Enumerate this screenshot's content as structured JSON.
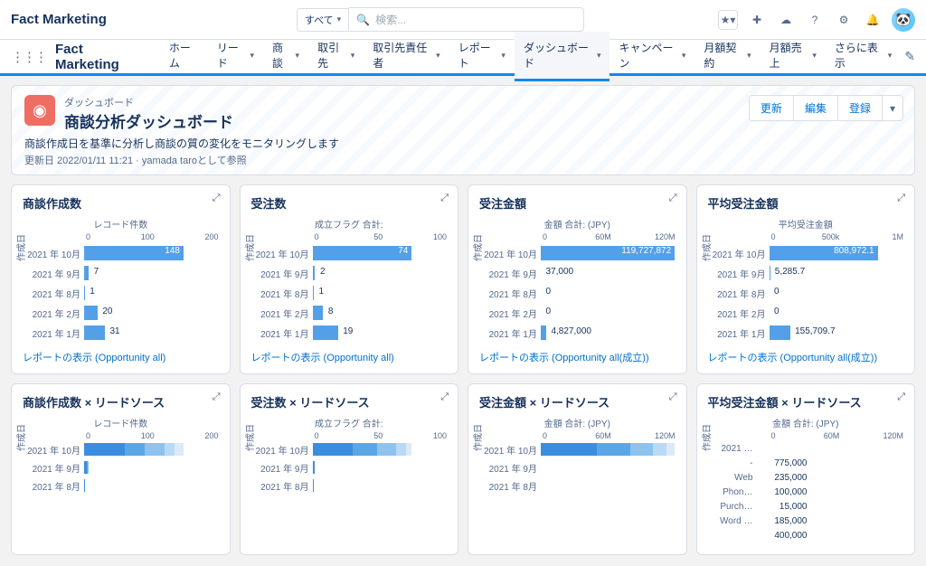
{
  "top": {
    "brand": "Fact Marketing",
    "scope": "すべて",
    "search_placeholder": "検索..."
  },
  "nav": {
    "app": "Fact Marketing",
    "items": [
      "ホーム",
      "リード",
      "商談",
      "取引先",
      "取引先責任者",
      "レポート",
      "ダッシュボード",
      "キャンペーン",
      "月額契約",
      "月額売上",
      "さらに表示"
    ],
    "active_index": 6
  },
  "header": {
    "sub": "ダッシュボード",
    "title": "商談分析ダッシュボード",
    "desc": "商談作成日を基準に分析し商談の質の変化をモニタリングします",
    "date": "更新日 2022/01/11 11:21 · yamada taroとして参照",
    "actions": [
      "更新",
      "編集",
      "登録",
      "▾"
    ]
  },
  "ylabel": "作成日",
  "chart_data": [
    {
      "id": "c1",
      "title": "商談作成数",
      "axis": "レコード件数",
      "ticks": [
        "0",
        "100",
        "200"
      ],
      "type": "bar",
      "max": 200,
      "categories": [
        "2021 年 10月",
        "2021 年 9月",
        "2021 年 8月",
        "2021 年 2月",
        "2021 年 1月"
      ],
      "values": [
        148,
        7,
        1,
        20,
        31
      ],
      "labels": [
        "148",
        "7",
        "1",
        "20",
        "31"
      ],
      "link": "レポートの表示 (Opportunity all)"
    },
    {
      "id": "c2",
      "title": "受注数",
      "axis": "成立フラグ 合計:",
      "ticks": [
        "0",
        "50",
        "100"
      ],
      "type": "bar",
      "max": 100,
      "categories": [
        "2021 年 10月",
        "2021 年 9月",
        "2021 年 8月",
        "2021 年 2月",
        "2021 年 1月"
      ],
      "values": [
        74,
        2,
        1,
        8,
        19
      ],
      "labels": [
        "74",
        "2",
        "1",
        "8",
        "19"
      ],
      "link": "レポートの表示 (Opportunity all)"
    },
    {
      "id": "c3",
      "title": "受注金額",
      "axis": "金額 合計: (JPY)",
      "ticks": [
        "0",
        "60M",
        "120M"
      ],
      "type": "bar",
      "max": 120000000,
      "categories": [
        "2021 年 10月",
        "2021 年 9月",
        "2021 年 8月",
        "2021 年 2月",
        "2021 年 1月"
      ],
      "values": [
        119727872,
        37000,
        0,
        0,
        4827000
      ],
      "labels": [
        "119,727,872",
        "37,000",
        "0",
        "0",
        "4,827,000"
      ],
      "link": "レポートの表示 (Opportunity all(成立))"
    },
    {
      "id": "c4",
      "title": "平均受注金額",
      "axis": "平均受注金額",
      "ticks": [
        "0",
        "500k",
        "1M"
      ],
      "type": "bar",
      "max": 1000000,
      "categories": [
        "2021 年 10月",
        "2021 年 9月",
        "2021 年 8月",
        "2021 年 2月",
        "2021 年 1月"
      ],
      "values": [
        808972.1,
        5285.7,
        0,
        0,
        155709.7
      ],
      "labels": [
        "808,972.1",
        "5,285.7",
        "0",
        "0",
        "155,709.7"
      ],
      "link": "レポートの表示 (Opportunity all(成立))"
    },
    {
      "id": "c5",
      "title": "商談作成数 × リードソース",
      "axis": "レコード件数",
      "ticks": [
        "0",
        "100",
        "200"
      ],
      "type": "stacked",
      "max": 200,
      "categories": [
        "2021 年 10月",
        "2021 年 9月",
        "2021 年 8月"
      ],
      "series_colors": [
        "#3b8ede",
        "#5aa7e8",
        "#8ec2ef",
        "#b9daf6",
        "#dceaf8"
      ],
      "stacks": [
        [
          60,
          30,
          30,
          15,
          13
        ],
        [
          4,
          2,
          1,
          0,
          0
        ],
        [
          1,
          0,
          0,
          0,
          0
        ]
      ]
    },
    {
      "id": "c6",
      "title": "受注数 × リードソース",
      "axis": "成立フラグ 合計:",
      "ticks": [
        "0",
        "50",
        "100"
      ],
      "type": "stacked",
      "max": 100,
      "categories": [
        "2021 年 10月",
        "2021 年 9月",
        "2021 年 8月"
      ],
      "series_colors": [
        "#3b8ede",
        "#5aa7e8",
        "#8ec2ef",
        "#b9daf6",
        "#dceaf8"
      ],
      "stacks": [
        [
          30,
          18,
          14,
          8,
          4
        ],
        [
          2,
          0,
          0,
          0,
          0
        ],
        [
          1,
          0,
          0,
          0,
          0
        ]
      ]
    },
    {
      "id": "c7",
      "title": "受注金額 × リードソース",
      "axis": "金額 合計: (JPY)",
      "ticks": [
        "0",
        "60M",
        "120M"
      ],
      "type": "stacked",
      "max": 120000000,
      "categories": [
        "2021 年 10月",
        "2021 年 9月",
        "2021 年 8月"
      ],
      "series_colors": [
        "#3b8ede",
        "#5aa7e8",
        "#8ec2ef",
        "#b9daf6",
        "#dceaf8"
      ],
      "stacks": [
        [
          50000000,
          30000000,
          20000000,
          12000000,
          8000000
        ],
        [
          37000,
          0,
          0,
          0,
          0
        ],
        [
          0,
          0,
          0,
          0,
          0
        ]
      ]
    },
    {
      "id": "c8",
      "title": "平均受注金額 × リードソース",
      "axis": "金額 合計: (JPY)",
      "ticks": [
        "0",
        "60M",
        "120M"
      ],
      "type": "table",
      "head_year": "2021 …",
      "rows": [
        {
          "a": "-",
          "b": "775,000"
        },
        {
          "a": "Web",
          "b": "235,000"
        },
        {
          "a": "Phon…",
          "b": "100,000"
        },
        {
          "a": "Purch…",
          "b": "15,000"
        },
        {
          "a": "Word …",
          "b": "185,000"
        },
        {
          "a": "",
          "b": "400,000"
        }
      ]
    }
  ]
}
